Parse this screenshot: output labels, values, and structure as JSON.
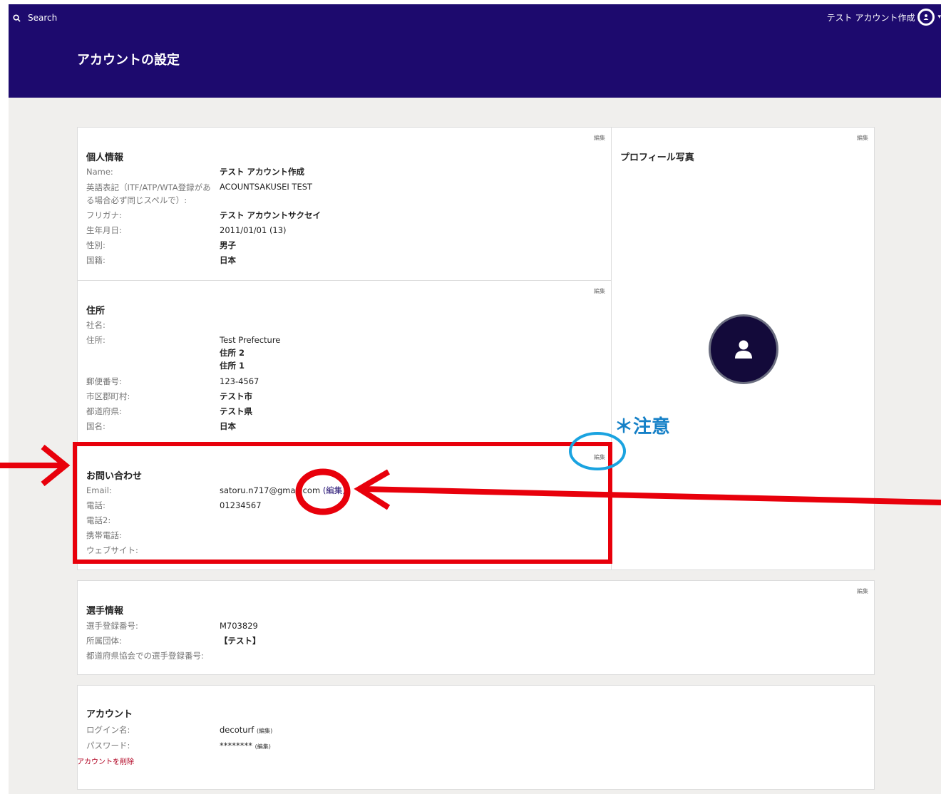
{
  "topbar": {
    "search_label": "Search",
    "user_name": "テスト アカウント作成",
    "page_title": "アカウントの設定",
    "bg_color": "#1d0a6e"
  },
  "edit_label": "編集",
  "personal": {
    "title": "個人情報",
    "rows": [
      {
        "label": "Name:",
        "value": "テスト アカウント作成"
      },
      {
        "label": "英語表記（ITF/ATP/WTA登録がある場合必ず同じスペルで）:",
        "value": "ACOUNTSAKUSEI TEST"
      },
      {
        "label": "フリガナ:",
        "value": "テスト アカウントサクセイ"
      },
      {
        "label": "生年月日:",
        "value": "2011/01/01 (13)"
      },
      {
        "label": "性別:",
        "value": "男子"
      },
      {
        "label": "国籍:",
        "value": "日本"
      }
    ]
  },
  "address": {
    "title": "住所",
    "rows": [
      {
        "label": "社名:",
        "value": ""
      },
      {
        "label": "住所:",
        "value": "Test Prefecture",
        "value2": "住所 2",
        "value3": "住所 1"
      },
      {
        "label": "郵便番号:",
        "value": "123-4567"
      },
      {
        "label": "市区郡町村:",
        "value": "テスト市"
      },
      {
        "label": "都道府県:",
        "value": "テスト県"
      },
      {
        "label": "国名:",
        "value": "日本"
      }
    ]
  },
  "contact": {
    "title": "お問い合わせ",
    "email_label": "Email:",
    "email": "satoru.n717@gmail.com",
    "email_edit": "(編集)",
    "phone_label": "電話:",
    "phone": "01234567",
    "phone2_label": "電話2:",
    "mobile_label": "携帯電話:",
    "website_label": "ウェブサイト:"
  },
  "profile": {
    "title": "プロフィール写真",
    "avatar_icon": "user-icon"
  },
  "player": {
    "title": "選手情報",
    "rows": [
      {
        "label": "選手登録番号:",
        "value": "M703829"
      },
      {
        "label": "所属団体:",
        "value": "【テスト】"
      },
      {
        "label": "都道府県協会での選手登録番号:",
        "value": ""
      }
    ]
  },
  "account": {
    "title": "アカウント",
    "login_label": "ログイン名:",
    "login": "decoturf",
    "login_edit": "(編集)",
    "password_label": "パスワード:",
    "password": "********",
    "password_edit": "(編集)"
  },
  "delete_account": "アカウントを削除",
  "annotation": {
    "note": "＊注意",
    "highlight_color": "#e8000b",
    "note_color": "#1580c7",
    "circle_color": "#1aa3e0"
  }
}
